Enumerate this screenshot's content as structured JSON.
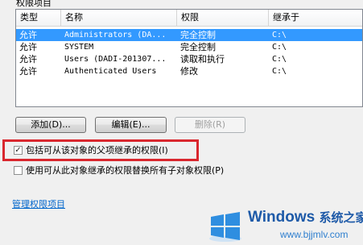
{
  "top_label": "权限项目",
  "listview": {
    "columns": [
      "类型",
      "名称",
      "权限",
      "继承于"
    ],
    "rows": [
      {
        "type": "允许",
        "name": "Administrators (DA...",
        "permission": "完全控制",
        "inherited_from": "C:\\",
        "selected": true
      },
      {
        "type": "允许",
        "name": "SYSTEM",
        "permission": "完全控制",
        "inherited_from": "C:\\",
        "selected": false
      },
      {
        "type": "允许",
        "name": "Users (DADI-201307...",
        "permission": "读取和执行",
        "inherited_from": "C:\\",
        "selected": false
      },
      {
        "type": "允许",
        "name": "Authenticated Users",
        "permission": "修改",
        "inherited_from": "C:\\",
        "selected": false
      }
    ]
  },
  "buttons": {
    "add": "添加(D)...",
    "edit": "编辑(E)...",
    "remove": "删除(R)"
  },
  "checkboxes": {
    "inherit": {
      "label": "包括可从该对象的父项继承的权限(I)",
      "checked": true
    },
    "replace": {
      "label": "使用可从此对象继承的权限替换所有子对象权限(P)",
      "checked": false
    }
  },
  "link": "管理权限项目",
  "watermark": {
    "title": "Windows",
    "subtitle": "系统之家",
    "url": "www.bjjmlv.com"
  },
  "colors": {
    "selection": "#3399ff",
    "highlight_border": "#d9272e",
    "link": "#0066cc"
  }
}
